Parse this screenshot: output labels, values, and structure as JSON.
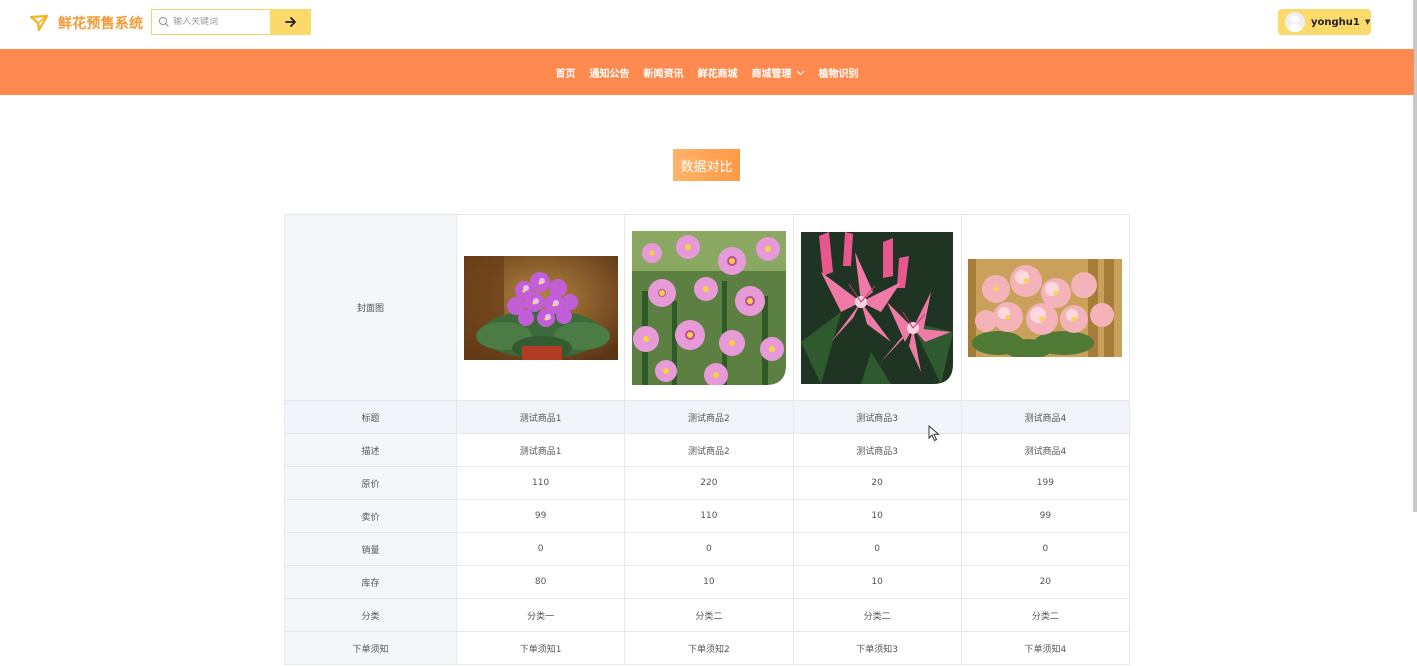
{
  "app": {
    "title": "鲜花预售系统",
    "brand_color": "#f59a34"
  },
  "search": {
    "placeholder": "输入关键词"
  },
  "user": {
    "name": "yonghu1"
  },
  "nav": {
    "items": [
      {
        "label": "首页"
      },
      {
        "label": "通知公告"
      },
      {
        "label": "新闻资讯"
      },
      {
        "label": "鲜花商城"
      },
      {
        "label": "商城管理",
        "has_dropdown": true
      },
      {
        "label": "植物识别"
      }
    ],
    "bg_color": "#ff8a4f"
  },
  "page": {
    "title": "数据对比"
  },
  "table": {
    "cover_label": "封面图",
    "rows": [
      {
        "label": "标题",
        "values": [
          "测试商品1",
          "测试商品2",
          "测试商品3",
          "测试商品4"
        ]
      },
      {
        "label": "描述",
        "values": [
          "测试商品1",
          "测试商品2",
          "测试商品3",
          "测试商品4"
        ]
      },
      {
        "label": "原价",
        "values": [
          "110",
          "220",
          "20",
          "199"
        ]
      },
      {
        "label": "卖价",
        "values": [
          "99",
          "110",
          "10",
          "99"
        ]
      },
      {
        "label": "销量",
        "values": [
          "0",
          "0",
          "0",
          "0"
        ]
      },
      {
        "label": "库存",
        "values": [
          "80",
          "10",
          "10",
          "20"
        ]
      },
      {
        "label": "分类",
        "values": [
          "分类一",
          "分类二",
          "分类二",
          "分类二"
        ]
      },
      {
        "label": "下单须知",
        "values": [
          "下单须知1",
          "下单须知2",
          "下单须知3",
          "下单须知4"
        ]
      }
    ],
    "images": [
      {
        "name": "african-violet-image"
      },
      {
        "name": "cosmos-flowers-image"
      },
      {
        "name": "pink-lily-image"
      },
      {
        "name": "pink-begonia-image"
      }
    ]
  }
}
